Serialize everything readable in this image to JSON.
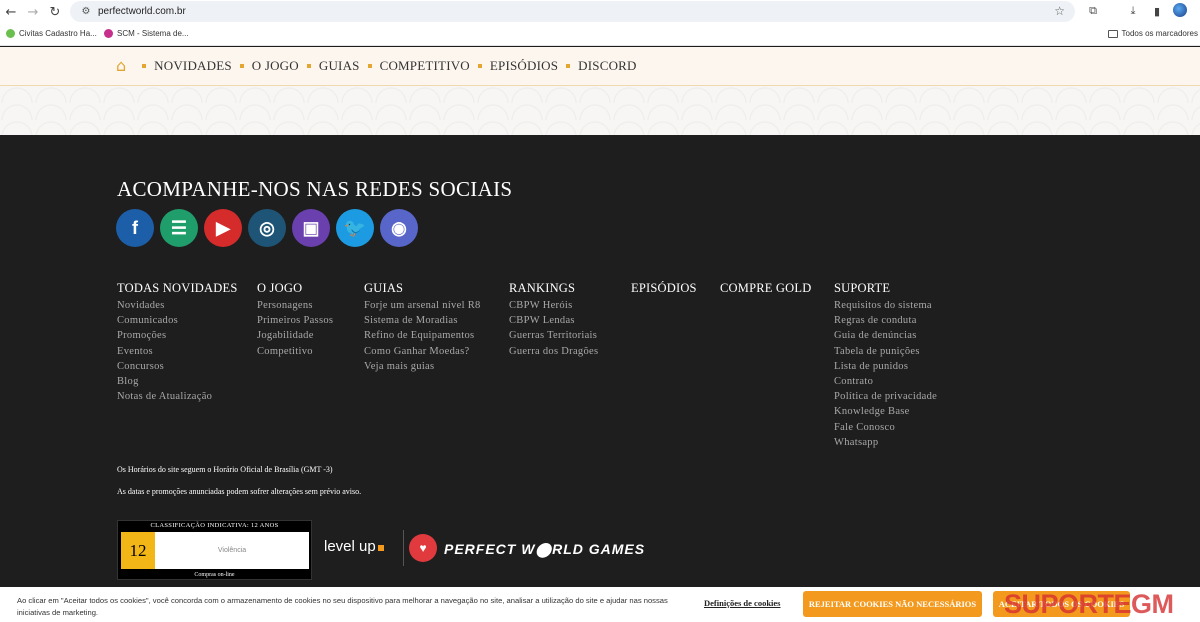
{
  "browser": {
    "url": "perfectworld.com.br",
    "bookmarks": [
      {
        "label": "Civitas Cadastro Ha...",
        "color": "#6bbf4e"
      },
      {
        "label": "SCM - Sistema de...",
        "color": "#c72f8c"
      }
    ],
    "all_bookmarks": "Todos os marcadores"
  },
  "site_nav": {
    "items": [
      "NOVIDADES",
      "O JOGO",
      "GUIAS",
      "COMPETITIVO",
      "EPISÓDIOS",
      "DISCORD"
    ]
  },
  "footer": {
    "social_title": "ACOMPANHE-NOS NAS REDES SOCIAIS",
    "socials": [
      {
        "icon": "facebook-icon",
        "glyph": "f",
        "color": "#1c5fa8"
      },
      {
        "icon": "forum-icon",
        "glyph": "☰",
        "color": "#1f9e6b"
      },
      {
        "icon": "youtube-icon",
        "glyph": "▶",
        "color": "#d52b2b"
      },
      {
        "icon": "instagram-icon",
        "glyph": "◎",
        "color": "#1e5577"
      },
      {
        "icon": "twitch-icon",
        "glyph": "▣",
        "color": "#6a3fae"
      },
      {
        "icon": "twitter-icon",
        "glyph": "🐦",
        "color": "#1d9be2"
      },
      {
        "icon": "discord-icon",
        "glyph": "◉",
        "color": "#5865c9"
      }
    ],
    "columns": [
      {
        "heading": "TODAS NOVIDADES",
        "links": [
          "Novidades",
          "Comunicados",
          "Promoções",
          "Eventos",
          "Concursos",
          "Blog",
          "Notas de Atualização"
        ]
      },
      {
        "heading": "O JOGO",
        "links": [
          "Personagens",
          "Primeiros Passos",
          "Jogabilidade",
          "Competitivo"
        ]
      },
      {
        "heading": "GUIAS",
        "links": [
          "Forje um arsenal nível R8",
          "Sistema de Moradias",
          "Refino de Equipamentos",
          "Como Ganhar Moedas?",
          "Veja mais guias"
        ]
      },
      {
        "heading": "RANKINGS",
        "links": [
          "CBPW Heróis",
          "CBPW Lendas",
          "Guerras Territoriais",
          "Guerra dos Dragões"
        ]
      },
      {
        "heading": "EPISÓDIOS",
        "links": []
      },
      {
        "heading": "COMPRE GOLD",
        "links": []
      },
      {
        "heading": "SUPORTE",
        "links": [
          "Requisitos do sistema",
          "Regras de conduta",
          "Guia de denúncias",
          "Tabela de punições",
          "Lista de punidos",
          "Contrato",
          "Política de privacidade",
          "Knowledge Base",
          "Fale Conosco",
          "Whatsapp"
        ]
      }
    ],
    "note1": "Os Horários do site seguem o Horário Oficial de Brasília (GMT -3)",
    "note2": "As datas e promoções anunciadas podem sofrer alterações sem prévio aviso.",
    "rating": {
      "title": "CLASSIFICAÇÃO INDICATIVA: 12 ANOS",
      "age": "12",
      "descriptor": "Violência",
      "bottom": "Compras on-line"
    },
    "levelup": "level up",
    "publisher": "PERFECT W⬤RLD GAMES"
  },
  "cookie_banner": {
    "text": "Ao clicar em \"Aceitar todos os cookies\", você concorda com o armazenamento de cookies no seu dispositivo para melhorar a navegação no site, analisar a utilização do site e ajudar nas nossas iniciativas de marketing.",
    "settings_label": "Definições de cookies",
    "reject_label": "REJEITAR COOKIES NÃO NECESSÁRIOS",
    "accept_label": "ACEITAR TODOS OS COOKIES"
  },
  "watermark": "SUPORTEGM"
}
